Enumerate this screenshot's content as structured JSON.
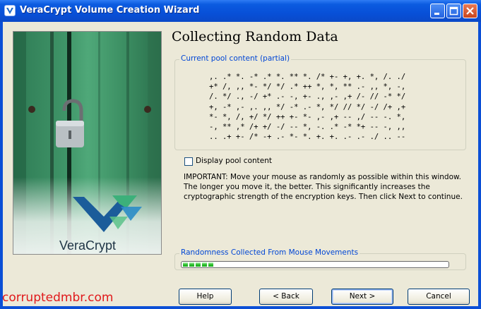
{
  "window": {
    "title": "VeraCrypt Volume Creation Wizard"
  },
  "page": {
    "title": "Collecting Random Data"
  },
  "pool": {
    "legend": "Current pool content (partial)",
    "lines": [
      ",. .* *. -* .* *. ** *. /* +- +, +. *, /. ./",
      "+* /, ,, *- */ */ .* ++ *, *, ** .- ,, *, -,",
      "/. */ ., -/ +* .- -, +- ., ,- ,+ /- // -* */",
      "+, -* ,- ,. ,, */ -* .- *, */ // */ -/ /+ ,+",
      "*- *, /, +/ */ ++ +- *- ,- ,+ -- ,/ -- -. *,",
      "-, ** ,* /+ +/ -/ -- *, -. .* -* *+ -- -, ,,",
      ".. .+ +- /* -+ .- *- *. +. +. .- .- ./ .. --"
    ]
  },
  "display_pool": {
    "label": "Display pool content",
    "checked": false
  },
  "important_text": "IMPORTANT: Move your mouse as randomly as possible within this window. The longer you move it, the better. This significantly increases the cryptographic strength of the encryption keys. Then click Next to continue.",
  "randomness": {
    "legend": "Randomness Collected From Mouse Movements",
    "progress_fraction": 0.1
  },
  "buttons": {
    "help": "Help",
    "back": "< Back",
    "next": "Next >",
    "cancel": "Cancel"
  },
  "image": {
    "brand": "VeraCrypt"
  },
  "watermark": "corruptedmbr.com",
  "colors": {
    "titlebar": "#0a55d8",
    "dialog_bg": "#ece9d8",
    "legend_text": "#0046d5",
    "progress": "#2cc12c",
    "watermark": "#e0191b"
  }
}
